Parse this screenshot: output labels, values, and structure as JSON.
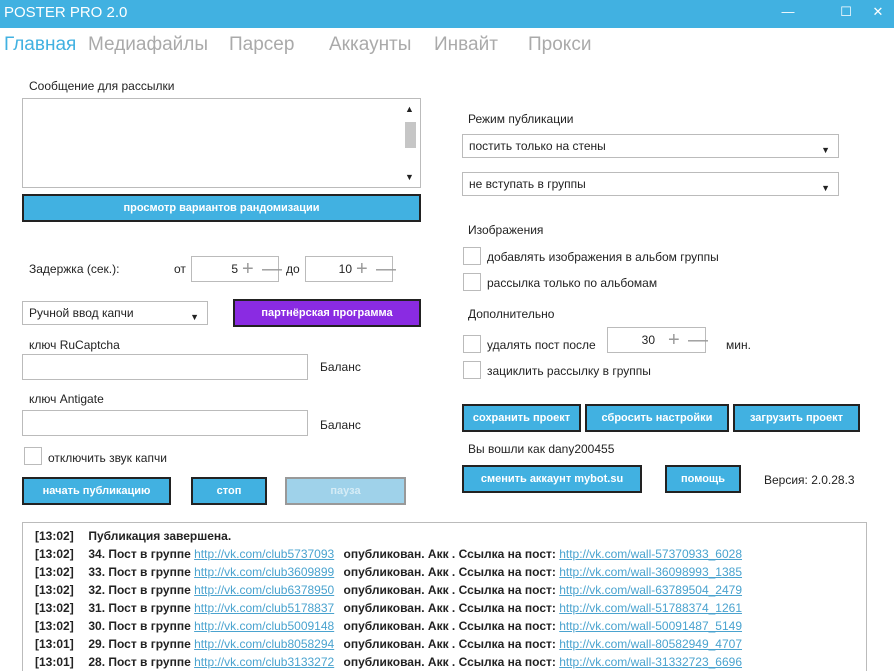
{
  "window": {
    "title": "POSTER PRO 2.0",
    "minimize": "—",
    "maximize": "☐",
    "close": "✕"
  },
  "menu": [
    "Главная",
    "Медиафайлы",
    "Парсер",
    "Аккаунты",
    "Инвайт",
    "Прокси"
  ],
  "message": {
    "label": "Сообщение для рассылки",
    "value": "",
    "randomize_button": "просмотр вариантов рандомизации"
  },
  "delay": {
    "label": "Задержка  (сек.):",
    "from_label": "от",
    "from_value": "5",
    "to_label": "до",
    "to_value": "10"
  },
  "captcha": {
    "mode": "Ручной ввод капчи",
    "partner_button": "партнёрская программа",
    "rucaptcha_label": "ключ RuCaptcha",
    "rucaptcha_value": "",
    "balance1": "Баланс",
    "antigate_label": "ключ Antigate",
    "antigate_value": "",
    "balance2": "Баланс",
    "mute_label": "отключить звук капчи"
  },
  "controls": {
    "start": "начать публикацию",
    "stop": "стоп",
    "pause": "пауза"
  },
  "publish": {
    "mode_label": "Режим публикации",
    "mode_value": "постить только на стены",
    "join_value": "не вступать в группы"
  },
  "images": {
    "label": "Изображения",
    "opt1": "добавлять изображения в альбом группы",
    "opt2": "рассылка только по альбомам"
  },
  "extra": {
    "label": "Дополнительно",
    "delete_label": "удалять пост после",
    "delete_value": "30",
    "unit": "мин.",
    "loop_label": "зациклить рассылку в группы"
  },
  "project": {
    "save": "сохранить проект",
    "reset": "сбросить настройки",
    "load": "загрузить проект"
  },
  "account": {
    "logged_in": "Вы вошли как dany200455",
    "change": "сменить аккаунт mybot.su",
    "help": "помощь",
    "version": "Версия: 2.0.28.3"
  },
  "log": [
    {
      "time": "[13:02]",
      "text": "Публикация завершена.",
      "group_link": "",
      "post_link": ""
    },
    {
      "time": "[13:02]",
      "text": "34. Пост в группе",
      "group_link": "http://vk.com/club5737093",
      "status": "опубликован. Акк . Ссылка на пост:",
      "post_link": "http://vk.com/wall-57370933_6028"
    },
    {
      "time": "[13:02]",
      "text": "33. Пост в группе",
      "group_link": "http://vk.com/club3609899",
      "status": "опубликован. Акк . Ссылка на пост:",
      "post_link": "http://vk.com/wall-36098993_1385"
    },
    {
      "time": "[13:02]",
      "text": "32. Пост в группе",
      "group_link": "http://vk.com/club6378950",
      "status": "опубликован. Акк . Ссылка на пост:",
      "post_link": "http://vk.com/wall-63789504_2479"
    },
    {
      "time": "[13:02]",
      "text": "31. Пост в группе",
      "group_link": "http://vk.com/club5178837",
      "status": "опубликован. Акк . Ссылка на пост:",
      "post_link": "http://vk.com/wall-51788374_1261"
    },
    {
      "time": "[13:02]",
      "text": "30. Пост в группе",
      "group_link": "http://vk.com/club5009148",
      "status": "опубликован. Акк . Ссылка на пост:",
      "post_link": "http://vk.com/wall-50091487_5149"
    },
    {
      "time": "[13:01]",
      "text": "29. Пост в группе",
      "group_link": "http://vk.com/club8058294",
      "status": "опубликован. Акк . Ссылка на пост:",
      "post_link": "http://vk.com/wall-80582949_4707"
    },
    {
      "time": "[13:01]",
      "text": "28. Пост в группе",
      "group_link": "http://vk.com/club3133272",
      "status": "опубликован. Акк . Ссылка на пост:",
      "post_link": "http://vk.com/wall-31332723_6696"
    }
  ],
  "colors": {
    "accent": "#41b1e1",
    "partner": "#8a2be2",
    "link": "#4aa3cf"
  }
}
